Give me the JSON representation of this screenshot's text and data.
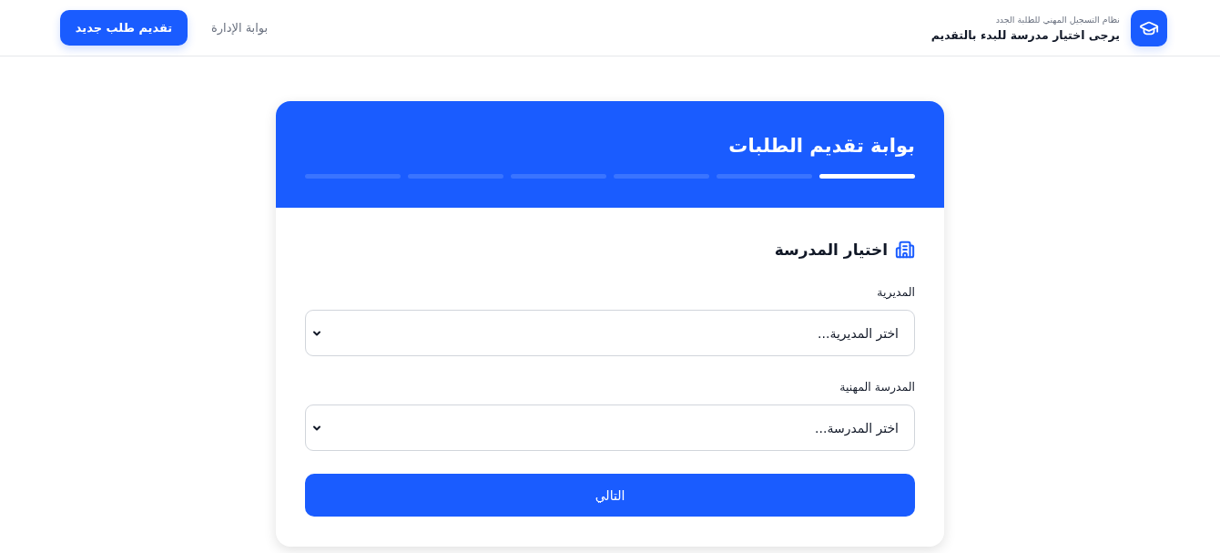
{
  "header": {
    "logo_subtitle": "نظام التسجيل المهني للطلبة الجدد",
    "logo_title": "يرجى اختيار مدرسة للبدء بالتقديم",
    "nav_link": "بوابة الإدارة",
    "cta_button": "تقديم طلب جديد"
  },
  "card": {
    "title": "بوابة تقديم الطلبات",
    "progress_steps": [
      {
        "active": true
      },
      {
        "active": false
      },
      {
        "active": false
      },
      {
        "active": false
      },
      {
        "active": false
      },
      {
        "active": false
      }
    ],
    "section_title": "اختيار المدرسة",
    "fields": [
      {
        "label": "المديرية",
        "value": "اختر المديرية..."
      },
      {
        "label": "المدرسة المهنية",
        "value": "اختر المدرسة..."
      }
    ],
    "next_button": "التالي"
  }
}
